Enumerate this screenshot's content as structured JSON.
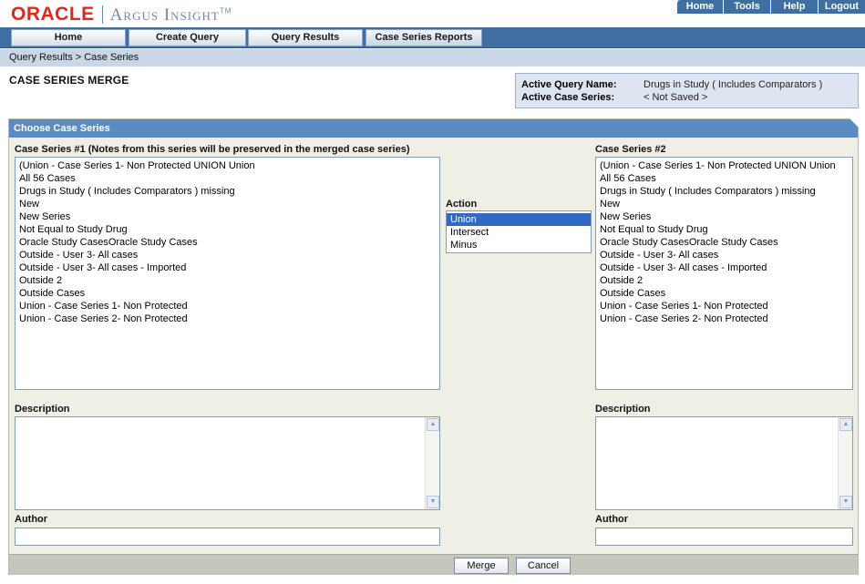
{
  "brand": {
    "oracle": "ORACLE",
    "product": "Argus Insight",
    "tm": "TM"
  },
  "top_links": [
    "Home",
    "Tools",
    "Help",
    "Logout"
  ],
  "nav_tabs": [
    "Home",
    "Create Query",
    "Query Results",
    "Case Series Reports"
  ],
  "breadcrumb": "Query Results  >  Case Series",
  "page_title": "CASE SERIES MERGE",
  "active_query": {
    "name_label": "Active Query Name:",
    "name_value": "Drugs in Study ( Includes Comparators )",
    "series_label": "Active Case Series:",
    "series_value": "< Not Saved >"
  },
  "panel": {
    "title": "Choose Case Series",
    "series1_label": "Case Series #1 (Notes from this series will be preserved in the merged case series)",
    "series2_label": "Case Series #2",
    "action_label": "Action",
    "actions": [
      "Union",
      "Intersect",
      "Minus"
    ],
    "selected_action": "Union",
    "series_items": [
      "(Union - Case Series 1- Non Protected UNION Union",
      "All 56 Cases",
      "Drugs in Study ( Includes Comparators ) missing",
      "New",
      "New Series",
      "Not Equal to Study Drug",
      "Oracle Study CasesOracle Study Cases",
      "Outside - User 3- All cases",
      "Outside - User 3- All cases - Imported",
      "Outside 2",
      "Outside Cases",
      "Union - Case Series 1- Non Protected",
      "Union - Case Series 2- Non Protected"
    ],
    "description_label": "Description",
    "author_label": "Author",
    "description1_value": "",
    "description2_value": "",
    "author1_value": "",
    "author2_value": ""
  },
  "buttons": {
    "merge": "Merge",
    "cancel": "Cancel"
  },
  "icons": {
    "scroll_up": "scroll-up-arrow-icon",
    "scroll_down": "scroll-down-arrow-icon"
  },
  "colors": {
    "brand_red": "#e3261c",
    "nav_blue": "#3f6ea3",
    "panel_header": "#5b8bc1",
    "selection": "#316ac5"
  }
}
